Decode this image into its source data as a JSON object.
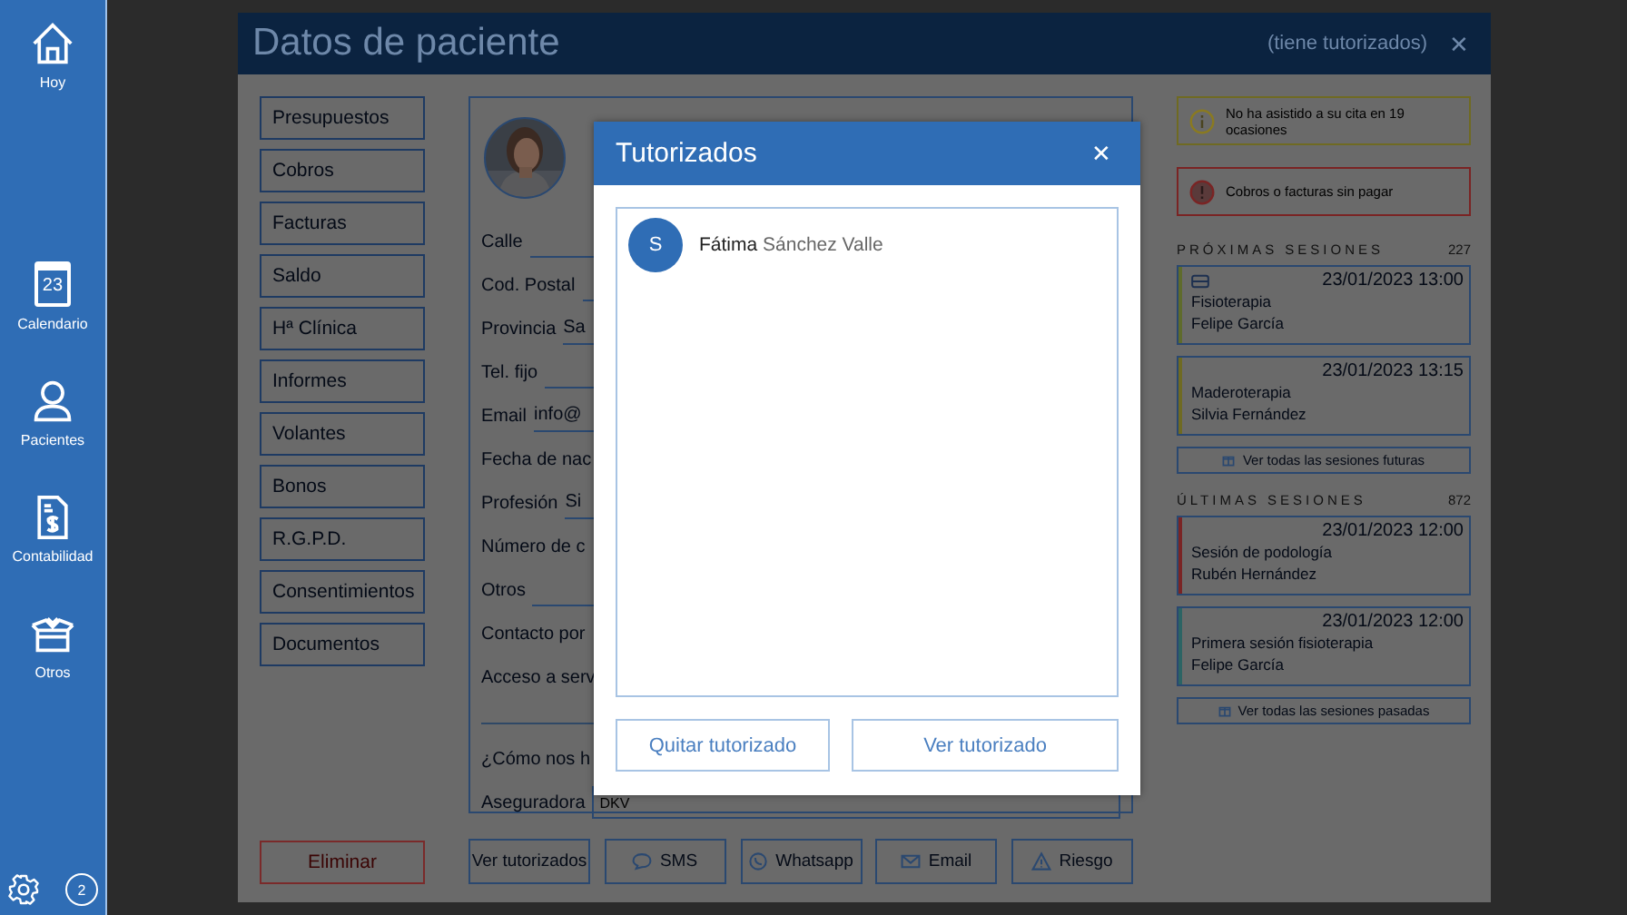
{
  "sidebar": {
    "items": [
      {
        "label": "Hoy",
        "kind": "home"
      },
      {
        "label": "Calendario",
        "kind": "calendar",
        "icon_text": "23"
      },
      {
        "label": "Pacientes",
        "kind": "person"
      },
      {
        "label": "Contabilidad",
        "kind": "invoice"
      },
      {
        "label": "Otros",
        "kind": "box"
      }
    ],
    "badge": "2"
  },
  "patient_window": {
    "title": "Datos de paciente",
    "subtitle": "(tiene tutorizados)",
    "close": "✕",
    "side_buttons": [
      "Presupuestos",
      "Cobros",
      "Facturas",
      "Saldo",
      "Hª Clínica",
      "Informes",
      "Volantes",
      "Bonos",
      "R.G.P.D.",
      "Consentimientos",
      "Documentos"
    ],
    "delete_button": "Eliminar",
    "form": {
      "fields": [
        {
          "label": "Calle",
          "kind": "line"
        },
        {
          "label": "Cod. Postal",
          "kind": "line"
        },
        {
          "label": "Provincia",
          "kind": "line",
          "value": "Sa"
        },
        {
          "label": "Tel. fijo",
          "kind": "line"
        },
        {
          "label": "Email",
          "kind": "line",
          "value": "info@"
        },
        {
          "label": "Fecha de nac",
          "kind": "text"
        },
        {
          "label": "Profesión",
          "kind": "line",
          "value": "Si"
        },
        {
          "label": "Número de c",
          "kind": "text"
        },
        {
          "label": "Otros",
          "kind": "line"
        },
        {
          "label": "Contacto por",
          "kind": "text"
        },
        {
          "label": "Acceso a serv",
          "kind": "text"
        },
        {
          "label": "¿Cómo nos h",
          "kind": "text"
        },
        {
          "label": "Aseguradora",
          "kind": "select",
          "value": "DKV"
        }
      ]
    },
    "actions": [
      {
        "label": "Ver tutorizados",
        "kind": "plain"
      },
      {
        "label": "SMS",
        "kind": "chat"
      },
      {
        "label": "Whatsapp",
        "kind": "phone"
      },
      {
        "label": "Email",
        "kind": "mail"
      },
      {
        "label": "Riesgo",
        "kind": "warning"
      }
    ],
    "alerts": [
      {
        "text": "No ha asistido a su cita en 19 ocasiones",
        "kind": "info"
      },
      {
        "text": "Cobros o facturas sin pagar",
        "kind": "error"
      }
    ],
    "upcoming": {
      "heading": "PRÓXIMAS SESIONES",
      "count": "227",
      "more_button": "Ver todas las sesiones futuras",
      "sessions": [
        {
          "time": "23/01/2023 13:00",
          "treatment": "Fisioterapia",
          "therapist": "Felipe García",
          "color": "#5f6b2c",
          "card_icon": true
        },
        {
          "time": "23/01/2023 13:15",
          "treatment": "Maderoterapia",
          "therapist": "Silvia Fernández",
          "color": "#6f6a22",
          "card_icon": false
        }
      ]
    },
    "past": {
      "heading": "ÚLTIMAS SESIONES",
      "count": "872",
      "more_button": "Ver todas las sesiones pasadas",
      "sessions": [
        {
          "time": "23/01/2023 12:00",
          "treatment": "Sesión de podología",
          "therapist": "Rubén Hernández",
          "color": "#7a2424",
          "card_icon": false
        },
        {
          "time": "23/01/2023 12:00",
          "treatment": "Primera sesión fisioterapia",
          "therapist": "Felipe García",
          "color": "#2c6464",
          "card_icon": false
        }
      ]
    }
  },
  "dialog": {
    "title": "Tutorizados",
    "close": "✕",
    "items": [
      {
        "initial": "S",
        "first_name": "Fátima",
        "last_name": "Sánchez Valle"
      }
    ],
    "buttons": [
      "Quitar tutorizado",
      "Ver tutorizado"
    ]
  }
}
